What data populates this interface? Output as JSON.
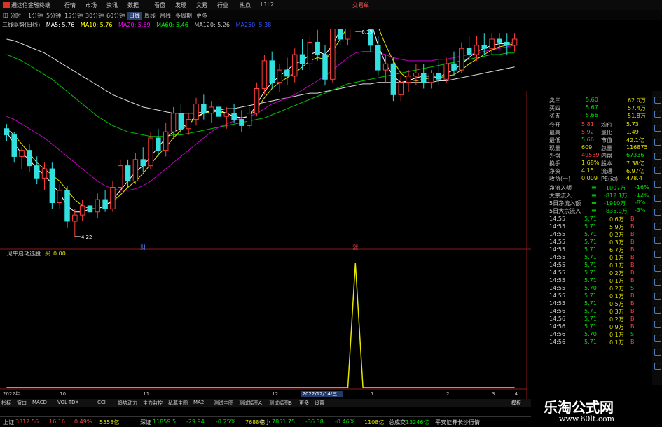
{
  "app": {
    "title": "通达信金融终端",
    "menu": [
      "行情",
      "市场",
      "资讯",
      "数据",
      "看盘",
      "发现",
      "文易",
      "行业",
      "热点",
      "L1L2"
    ],
    "corner": "交易单"
  },
  "timeframes": {
    "items": [
      "分时",
      "1分钟",
      "5分钟",
      "15分钟",
      "30分钟",
      "60分钟",
      "日线",
      "周线",
      "月线",
      "多周期",
      "更多"
    ],
    "selected": "日线"
  },
  "ma_legend": {
    "name": "三线驱势(日线)",
    "items": [
      {
        "label": "MA5: 5.76",
        "color": "#ffffff"
      },
      {
        "label": "MA10: 5.76",
        "color": "#ffff00"
      },
      {
        "label": "MA20: 5.69",
        "color": "#ff00ff"
      },
      {
        "label": "MA60: 5.46",
        "color": "#00ff00"
      },
      {
        "label": "MA120: 5.26",
        "color": "#c0c0c0"
      },
      {
        "label": "MA250: 5.38",
        "color": "#3355ff"
      }
    ]
  },
  "chart_data": [
    {
      "type": "candlestick",
      "title": "",
      "y_ticks": [
        "5.50",
        "5.40",
        "5.30",
        "5.20",
        "5.10",
        "5.00",
        "4.90",
        "4.80",
        "4.70",
        "4.60",
        "4.50",
        "4.40",
        "4.30",
        "4.20"
      ],
      "ylim": [
        4.17,
        5.55
      ],
      "high_label": "6.15",
      "low_label": "4.22",
      "markers": [
        {
          "label": "财",
          "color": "#4a86ff"
        },
        {
          "label": "涨",
          "color": "#ff4444"
        }
      ],
      "candles": [
        [
          4.92,
          4.95,
          4.84,
          4.88
        ],
        [
          4.88,
          4.9,
          4.7,
          4.74
        ],
        [
          4.74,
          4.8,
          4.66,
          4.78
        ],
        [
          4.78,
          4.82,
          4.64,
          4.68
        ],
        [
          4.68,
          4.74,
          4.56,
          4.6
        ],
        [
          4.6,
          4.7,
          4.52,
          4.66
        ],
        [
          4.66,
          4.7,
          4.4,
          4.44
        ],
        [
          4.44,
          4.56,
          4.4,
          4.52
        ],
        [
          4.52,
          4.55,
          4.28,
          4.32
        ],
        [
          4.32,
          4.4,
          4.22,
          4.36
        ],
        [
          4.36,
          4.46,
          4.32,
          4.42
        ],
        [
          4.42,
          4.48,
          4.34,
          4.38
        ],
        [
          4.38,
          4.5,
          4.34,
          4.46
        ],
        [
          4.46,
          4.52,
          4.38,
          4.4
        ],
        [
          4.4,
          4.58,
          4.38,
          4.54
        ],
        [
          4.54,
          4.72,
          4.5,
          4.68
        ],
        [
          4.68,
          4.72,
          4.54,
          4.58
        ],
        [
          4.58,
          4.76,
          4.56,
          4.72
        ],
        [
          4.72,
          4.8,
          4.64,
          4.68
        ],
        [
          4.68,
          4.9,
          4.66,
          4.86
        ],
        [
          4.86,
          4.92,
          4.74,
          4.78
        ],
        [
          4.78,
          4.96,
          4.74,
          4.9
        ],
        [
          4.9,
          5.06,
          4.86,
          5.02
        ],
        [
          5.02,
          5.08,
          4.88,
          4.92
        ],
        [
          4.92,
          5.02,
          4.88,
          4.98
        ],
        [
          4.98,
          5.12,
          4.94,
          5.08
        ],
        [
          5.08,
          5.14,
          4.98,
          5.02
        ],
        [
          5.02,
          5.1,
          4.96,
          5.06
        ],
        [
          5.06,
          5.1,
          4.98,
          5.0
        ],
        [
          5.0,
          5.06,
          4.92,
          5.02
        ],
        [
          5.02,
          5.08,
          4.96,
          4.98
        ],
        [
          4.98,
          5.04,
          4.9,
          4.94
        ],
        [
          4.94,
          5.06,
          4.92,
          5.02
        ],
        [
          5.02,
          5.22,
          5.0,
          5.18
        ],
        [
          5.18,
          5.4,
          5.14,
          5.36
        ],
        [
          5.36,
          5.42,
          5.18,
          5.22
        ],
        [
          5.22,
          5.34,
          5.16,
          5.3
        ],
        [
          5.3,
          5.38,
          5.2,
          5.26
        ],
        [
          5.26,
          5.44,
          5.22,
          5.4
        ],
        [
          5.4,
          5.5,
          5.3,
          5.34
        ],
        [
          5.34,
          5.52,
          5.3,
          5.48
        ],
        [
          5.48,
          5.56,
          5.36,
          5.4
        ],
        [
          5.4,
          5.46,
          5.2,
          5.24
        ],
        [
          5.24,
          5.7,
          5.22,
          5.66
        ],
        [
          5.66,
          5.74,
          5.46,
          5.5
        ],
        [
          5.5,
          5.9,
          5.46,
          5.82
        ],
        [
          5.82,
          6.15,
          5.7,
          5.96
        ],
        [
          5.96,
          6.02,
          5.64,
          5.7
        ],
        [
          5.7,
          5.74,
          5.42,
          5.46
        ],
        [
          5.46,
          5.52,
          5.26,
          5.3
        ],
        [
          5.3,
          5.4,
          5.22,
          5.34
        ],
        [
          5.34,
          5.38,
          5.1,
          5.14
        ],
        [
          5.14,
          5.26,
          5.1,
          5.22
        ],
        [
          5.22,
          5.3,
          5.16,
          5.26
        ],
        [
          5.26,
          5.34,
          5.2,
          5.28
        ],
        [
          5.28,
          5.34,
          5.18,
          5.22
        ],
        [
          5.22,
          5.3,
          5.18,
          5.28
        ],
        [
          5.28,
          5.36,
          5.2,
          5.24
        ],
        [
          5.24,
          5.38,
          5.22,
          5.34
        ],
        [
          5.34,
          5.42,
          5.26,
          5.3
        ],
        [
          5.3,
          5.48,
          5.28,
          5.44
        ],
        [
          5.44,
          5.52,
          5.36,
          5.4
        ],
        [
          5.4,
          5.52,
          5.36,
          5.46
        ],
        [
          5.46,
          5.54,
          5.4,
          5.44
        ],
        [
          5.44,
          5.54,
          5.4,
          5.5
        ],
        [
          5.5,
          5.54,
          5.44,
          5.48
        ],
        [
          5.48,
          5.54,
          5.4,
          5.46
        ],
        [
          5.46,
          5.54,
          5.42,
          5.5
        ]
      ],
      "series": [
        {
          "color": "#dddddd",
          "values": [
            5.5,
            5.49,
            5.47,
            5.45,
            5.43,
            5.41,
            5.38,
            5.35,
            5.32,
            5.29,
            5.26,
            5.23,
            5.2,
            5.17,
            5.14,
            5.12,
            5.1,
            5.08,
            5.06,
            5.05,
            5.04,
            5.03,
            5.02,
            5.02,
            5.02,
            5.02,
            5.03,
            5.03,
            5.04,
            5.05,
            5.05,
            5.06,
            5.07,
            5.08,
            5.09,
            5.1,
            5.11,
            5.12,
            5.13,
            5.14,
            5.15,
            5.15,
            5.16,
            5.17,
            5.18,
            5.19,
            5.2,
            5.21,
            5.21,
            5.22,
            5.22,
            5.22,
            5.22,
            5.22,
            5.22,
            5.22,
            5.22,
            5.23,
            5.23,
            5.24,
            5.25,
            5.26,
            5.27,
            5.28,
            5.29,
            5.3,
            5.31,
            5.32
          ]
        },
        {
          "color": "#00c000",
          "values": [
            5.4,
            5.38,
            5.36,
            5.33,
            5.3,
            5.27,
            5.24,
            5.2,
            5.16,
            5.12,
            5.08,
            5.04,
            5.0,
            4.97,
            4.94,
            4.92,
            4.9,
            4.89,
            4.88,
            4.87,
            4.87,
            4.87,
            4.88,
            4.88,
            4.89,
            4.9,
            4.91,
            4.92,
            4.93,
            4.94,
            4.95,
            4.96,
            4.97,
            4.98,
            4.99,
            5.01,
            5.03,
            5.05,
            5.07,
            5.09,
            5.11,
            5.13,
            5.15,
            5.17,
            5.19,
            5.21,
            5.22,
            5.23,
            5.24,
            5.25,
            5.26,
            5.27,
            5.28,
            5.29,
            5.3,
            5.31,
            5.32,
            5.33,
            5.34,
            5.35,
            5.36,
            5.37,
            5.38,
            5.39,
            5.4,
            5.4,
            5.41,
            5.41
          ]
        },
        {
          "color": "#c000c0",
          "values": [
            5.0,
            4.98,
            4.95,
            4.92,
            4.89,
            4.86,
            4.82,
            4.78,
            4.74,
            4.7,
            4.66,
            4.62,
            4.58,
            4.55,
            4.53,
            4.52,
            4.52,
            4.53,
            4.55,
            4.58,
            4.62,
            4.66,
            4.7,
            4.74,
            4.78,
            4.82,
            4.86,
            4.9,
            4.93,
            4.95,
            4.97,
            4.99,
            5.0,
            5.02,
            5.05,
            5.08,
            5.1,
            5.12,
            5.14,
            5.17,
            5.2,
            5.23,
            5.26,
            5.3,
            5.34,
            5.38,
            5.41,
            5.42,
            5.42,
            5.41,
            5.4,
            5.38,
            5.37,
            5.36,
            5.36,
            5.36,
            5.36,
            5.37,
            5.37,
            5.38,
            5.39,
            5.4,
            5.41,
            5.42,
            5.43,
            5.44,
            5.45,
            5.46
          ]
        },
        {
          "color": "#e6e600",
          "values": [
            4.92,
            4.88,
            4.82,
            4.76,
            4.7,
            4.66,
            4.62,
            4.58,
            4.52,
            4.46,
            4.42,
            4.4,
            4.4,
            4.42,
            4.45,
            4.49,
            4.54,
            4.58,
            4.63,
            4.69,
            4.75,
            4.8,
            4.86,
            4.91,
            4.95,
            4.99,
            5.02,
            5.03,
            5.03,
            5.02,
            5.0,
            4.99,
            5.0,
            5.05,
            5.12,
            5.18,
            5.22,
            5.25,
            5.28,
            5.32,
            5.36,
            5.38,
            5.37,
            5.42,
            5.5,
            5.58,
            5.66,
            5.7,
            5.67,
            5.58,
            5.46,
            5.36,
            5.28,
            5.24,
            5.23,
            5.24,
            5.25,
            5.25,
            5.26,
            5.27,
            5.3,
            5.34,
            5.37,
            5.4,
            5.43,
            5.45,
            5.46,
            5.47
          ]
        },
        {
          "color": "#ffffff",
          "values": [
            4.9,
            4.82,
            4.76,
            4.72,
            4.66,
            4.62,
            4.56,
            4.5,
            4.42,
            4.38,
            4.38,
            4.4,
            4.4,
            4.42,
            4.46,
            4.52,
            4.58,
            4.64,
            4.68,
            4.74,
            4.8,
            4.86,
            4.9,
            4.92,
            4.96,
            5.0,
            5.02,
            5.04,
            5.04,
            5.02,
            5.0,
            4.99,
            5.0,
            5.08,
            5.16,
            5.22,
            5.26,
            5.3,
            5.34,
            5.36,
            5.4,
            5.42,
            5.4,
            5.46,
            5.56,
            5.68,
            5.74,
            5.72,
            5.62,
            5.46,
            5.34,
            5.26,
            5.22,
            5.23,
            5.25,
            5.26,
            5.26,
            5.25,
            5.28,
            5.3,
            5.34,
            5.38,
            5.42,
            5.44,
            5.46,
            5.47,
            5.47,
            5.48
          ]
        }
      ]
    },
    {
      "type": "line",
      "title": "见牛启动选股",
      "series": [
        {
          "name": "买",
          "color": "#e6e600",
          "values": [
            0,
            0,
            0,
            0,
            0,
            0,
            0,
            0,
            0,
            0,
            0,
            0,
            0,
            0,
            0,
            0,
            0,
            0,
            0,
            0,
            0,
            0,
            0,
            0,
            0,
            0,
            0,
            0,
            0,
            0,
            0,
            0,
            0,
            0,
            0,
            0,
            0,
            0,
            0,
            0,
            0,
            0,
            0,
            0,
            0,
            0,
            1,
            0,
            0,
            0,
            0,
            0,
            0,
            0,
            0,
            0,
            0,
            0,
            0,
            0,
            0,
            0,
            0,
            0,
            0,
            0,
            0,
            0
          ]
        }
      ],
      "legend_value": "0.00",
      "y_ticks": [
        "1.00",
        "0.90",
        "0.80",
        "0.70",
        "0.60",
        "0.50",
        "0.40",
        "0.30",
        "0.20",
        "0.10",
        "0.00"
      ],
      "ylim": [
        0,
        1
      ],
      "x_ticks": [
        "2022年",
        "10",
        "11",
        "12",
        "2022/12/14/三",
        "1",
        "2",
        "3",
        "4"
      ],
      "x_tick_index": [
        0,
        7,
        18,
        35,
        39,
        48,
        58,
        64,
        67
      ]
    }
  ],
  "quote_panel": {
    "rows": [
      {
        "k": "卖三",
        "v": "5.60",
        "n": "62.0万"
      },
      {
        "k": "买四",
        "v": "5.67",
        "n": "57.4万"
      },
      {
        "k": "买五",
        "v": "5.66",
        "n": "51.8万"
      },
      {
        "k": "今开",
        "v": "5.81",
        "k2": "均价",
        "v2": "5.73"
      },
      {
        "k": "最高",
        "v": "5.92",
        "k2": "量比",
        "v2": "1.49"
      },
      {
        "k": "最低",
        "v": "5.66",
        "k2": "市值",
        "v2": "42.1亿"
      },
      {
        "k": "现量",
        "v": "609",
        "k2": "总量",
        "v2": "116875"
      },
      {
        "k": "外盘",
        "v": "49539",
        "k2": "内盘",
        "v2": "67336"
      },
      {
        "k": "换手",
        "v": "1.68%",
        "k2": "股本",
        "v2": "7.38亿"
      },
      {
        "k": "净资",
        "v": "4.15",
        "k2": "流通",
        "v2": "6.97亿"
      },
      {
        "k": "收益(一)",
        "v": "0.009",
        "k2": "PE(动)",
        "v2": "478.4"
      }
    ],
    "flows": [
      {
        "k": "净流入额",
        "v": "-1007万",
        "p": "-16%"
      },
      {
        "k": "大宗流入",
        "v": "-812.1万",
        "p": "-12%"
      },
      {
        "k": "5日净流入额",
        "v": "-1910万",
        "p": "-8%"
      },
      {
        "k": "5日大宗流入",
        "v": "-835.9万",
        "p": "-3%"
      }
    ],
    "ticks": [
      {
        "t": "14:55",
        "p": "5.71",
        "v": "0.6万",
        "d": "B"
      },
      {
        "t": "14:55",
        "p": "5.71",
        "v": "5.9万",
        "d": "B"
      },
      {
        "t": "14:55",
        "p": "5.71",
        "v": "0.2万",
        "d": "B"
      },
      {
        "t": "14:55",
        "p": "5.71",
        "v": "0.3万",
        "d": "B"
      },
      {
        "t": "14:55",
        "p": "5.71",
        "v": "6.7万",
        "d": "B"
      },
      {
        "t": "14:55",
        "p": "5.71",
        "v": "0.1万",
        "d": "B"
      },
      {
        "t": "14:55",
        "p": "5.71",
        "v": "0.1万",
        "d": "B"
      },
      {
        "t": "14:55",
        "p": "5.71",
        "v": "0.2万",
        "d": "B"
      },
      {
        "t": "14:55",
        "p": "5.71",
        "v": "0.1万",
        "d": "B"
      },
      {
        "t": "14:55",
        "p": "5.70",
        "v": "0.2万",
        "d": "S"
      },
      {
        "t": "14:55",
        "p": "5.71",
        "v": "0.1万",
        "d": "B"
      },
      {
        "t": "14:55",
        "p": "5.71",
        "v": "0.5万",
        "d": "B"
      },
      {
        "t": "14:56",
        "p": "5.71",
        "v": "0.3万",
        "d": "B"
      },
      {
        "t": "14:56",
        "p": "5.71",
        "v": "0.2万",
        "d": "B"
      },
      {
        "t": "14:56",
        "p": "5.71",
        "v": "0.9万",
        "d": "B"
      },
      {
        "t": "14:56",
        "p": "5.70",
        "v": "0.1万",
        "d": "S"
      },
      {
        "t": "14:56",
        "p": "5.71",
        "v": "0.1万",
        "d": "B"
      }
    ]
  },
  "bottom_tabs": [
    "指标",
    "窗口",
    "MACD",
    "VOL-TDX",
    "CCI",
    "趋势动力",
    "主力监控",
    "私募主图",
    "MA2",
    "测试主图",
    "测试幅图A",
    "测试幅图B",
    "更多",
    "设置"
  ],
  "bottom_right": "模板",
  "status": [
    {
      "k": "上证",
      "v": "3312.56",
      "c1": "16.16",
      "c2": "0.49%",
      "c3": "5558亿"
    },
    {
      "k": "深证",
      "v": "11859.5",
      "c1": "-29.94",
      "c2": "-0.25%",
      "c3": "7688亿"
    },
    {
      "k": "中小",
      "v": "7851.75",
      "c1": "-36.38",
      "c2": "-0.46%",
      "c3": "1108亿"
    },
    {
      "k": "总成交",
      "v": "13246亿",
      "c1": "平安证券长沙行情",
      "c2": "",
      "c3": ""
    }
  ],
  "watermark": {
    "title": "乐淘公式网",
    "url": "www.60lt.com"
  }
}
